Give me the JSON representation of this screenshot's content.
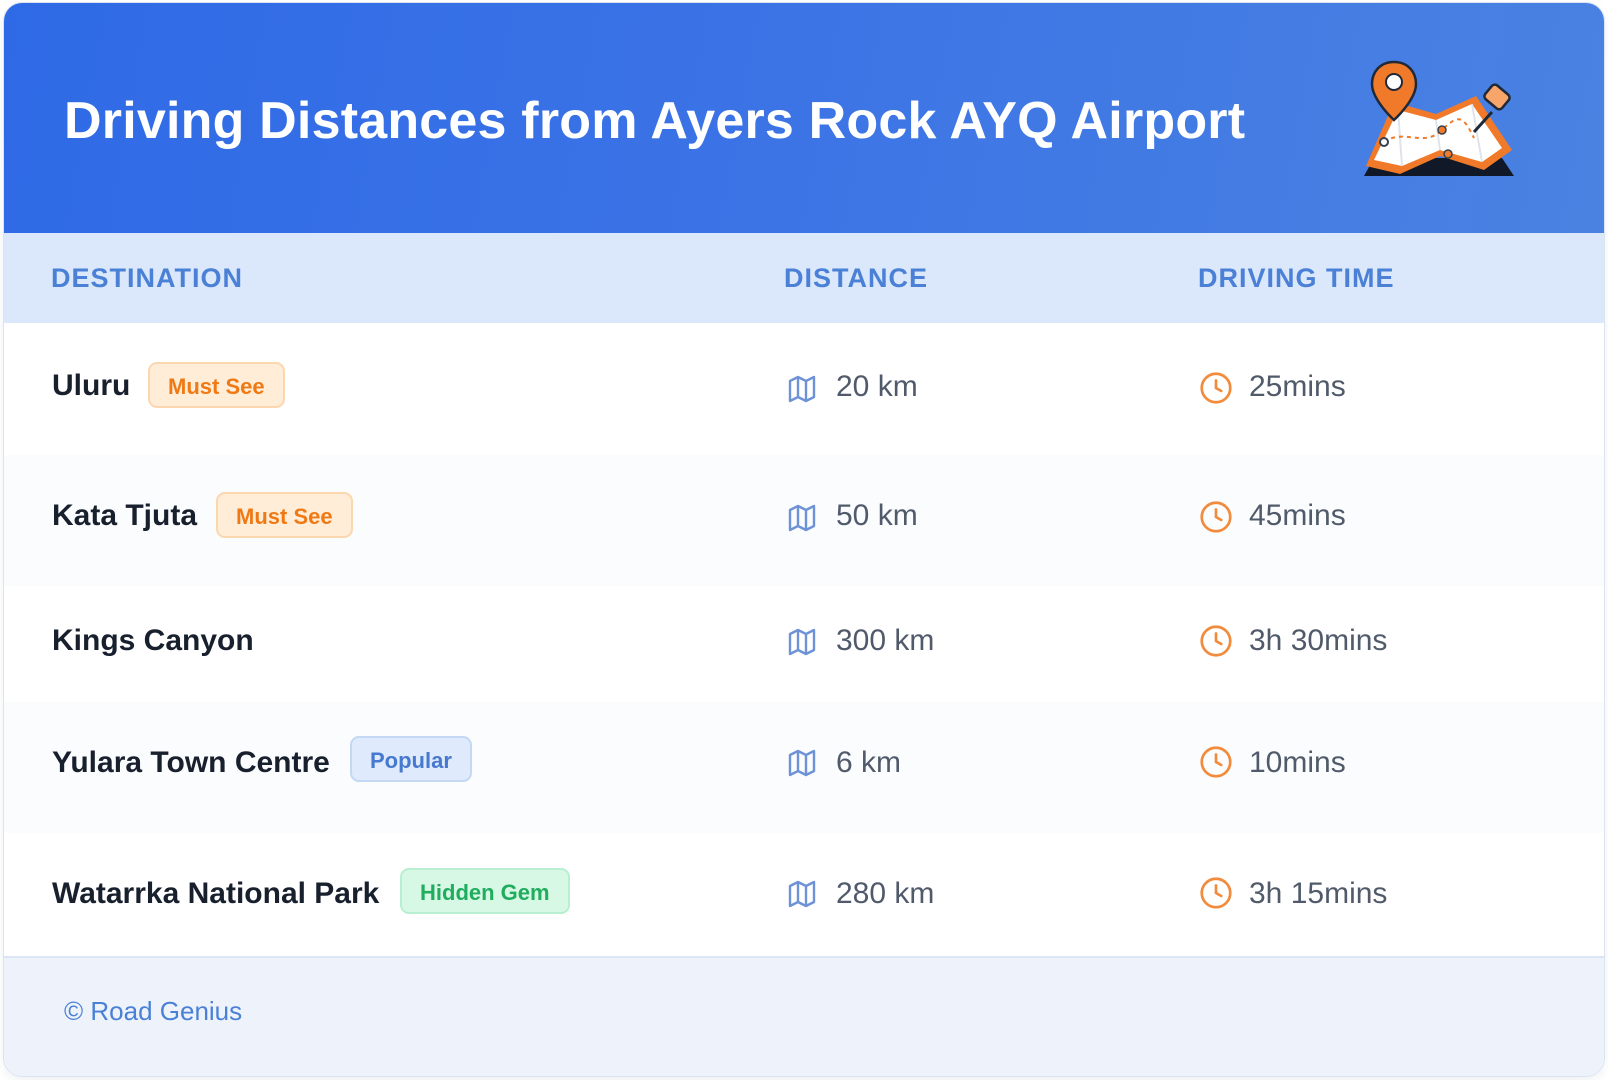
{
  "header": {
    "title": "Driving Distances from Ayers Rock AYQ Airport",
    "illustration": "map-with-pins-icon"
  },
  "columns": {
    "destination": "DESTINATION",
    "distance": "DISTANCE",
    "time": "DRIVING TIME"
  },
  "rows": [
    {
      "destination": "Uluru",
      "badge": "Must See",
      "badge_color": "orange",
      "distance": "20 km",
      "time": "25mins"
    },
    {
      "destination": "Kata Tjuta",
      "badge": "Must See",
      "badge_color": "orange",
      "distance": "50 km",
      "time": "45mins"
    },
    {
      "destination": "Kings Canyon",
      "badge": "",
      "badge_color": "",
      "distance": "300 km",
      "time": "3h 30mins"
    },
    {
      "destination": "Yulara Town Centre",
      "badge": "Popular",
      "badge_color": "blue",
      "distance": "6 km",
      "time": "10mins"
    },
    {
      "destination": "Watarrka National Park",
      "badge": "Hidden Gem",
      "badge_color": "green",
      "distance": "280 km",
      "time": "3h 15mins"
    }
  ],
  "icons": {
    "distance": "map-icon",
    "time": "clock-icon"
  },
  "colors": {
    "header_bg": "#3b73e6",
    "accent": "#4a80d6",
    "orange": "#ef7a15",
    "green": "#20ad5e"
  },
  "footer": {
    "text": "© Road Genius"
  }
}
